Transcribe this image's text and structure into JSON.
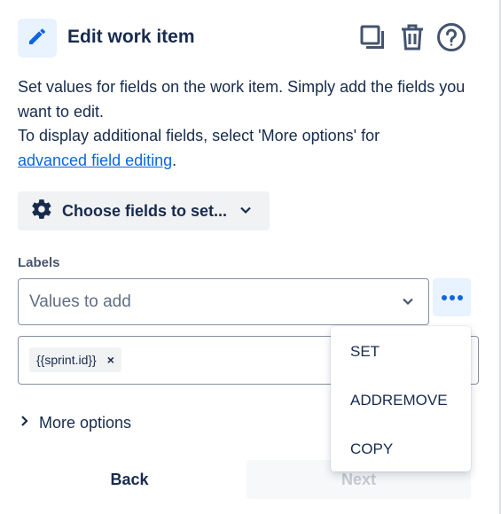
{
  "header": {
    "title": "Edit work item",
    "icons": [
      "pencil-icon",
      "copy-icon",
      "trash-icon",
      "help-icon"
    ]
  },
  "description": {
    "line1": "Set values for fields on the work item. Simply add the fields you want to edit.",
    "line2": "To display additional fields, select 'More options' for",
    "link": "advanced field editing",
    "suffix": "."
  },
  "choose_fields": {
    "label": "Choose fields to set...",
    "icon": "gear-icon"
  },
  "labels_field": {
    "label": "Labels",
    "placeholder": "Values to add",
    "tags": [
      "{{sprint.id}}"
    ],
    "remove_glyph": "×"
  },
  "more_menu": {
    "icon": "more-horizontal-icon",
    "items": [
      "SET",
      "ADDREMOVE",
      "COPY"
    ]
  },
  "more_options": {
    "label": "More options"
  },
  "footer": {
    "back_label": "Back",
    "next_label": "Next"
  },
  "colors": {
    "accent": "#0c66e4",
    "text": "#172b4d",
    "icon_bg": "#e9f2ff"
  }
}
